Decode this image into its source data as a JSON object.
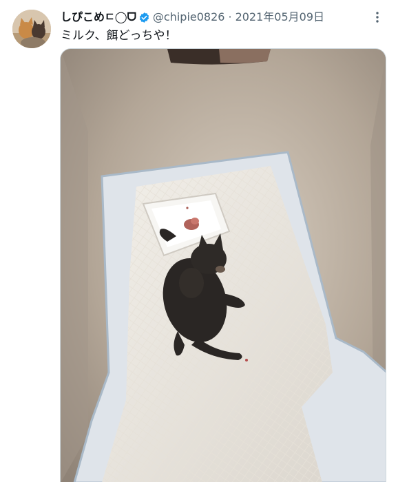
{
  "tweet": {
    "display_name": "しぴこめㄷ◯ᗜ",
    "handle": "@chipie0826",
    "separator": "·",
    "date": "2021年05月09日",
    "text": "ミルク、餌どっちや！",
    "verified_color": "#1d9bf0"
  },
  "icons": {
    "verified": "verified-badge-icon",
    "more": "more-options-icon"
  }
}
